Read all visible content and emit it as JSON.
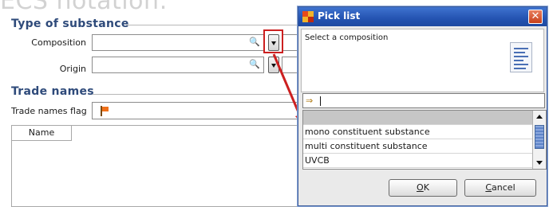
{
  "page": {
    "cut_off_heading": "ECS notation:"
  },
  "substance": {
    "title": "Type of substance",
    "composition_label": "Composition",
    "composition_value": "",
    "origin_label": "Origin",
    "origin_value": ""
  },
  "trade": {
    "title": "Trade names",
    "flag_label": "Trade names flag",
    "column_name": "Name"
  },
  "dialog": {
    "title": "Pick list",
    "close_glyph": "✕",
    "prompt": "Select a composition",
    "filter_value": "",
    "items": [
      {
        "label": ""
      },
      {
        "label": "mono constituent substance"
      },
      {
        "label": "multi constituent substance"
      },
      {
        "label": "UVCB"
      },
      {
        "label": ""
      }
    ],
    "ok_accel": "O",
    "ok_rest": "K",
    "cancel_accel": "C",
    "cancel_rest": "ancel"
  },
  "icons": {
    "search": "magnifier-icon",
    "dropdown": "triangle-down-icon",
    "flag": "flag-icon",
    "filter": "filter-icon",
    "document": "document-list-icon",
    "close": "close-icon"
  },
  "colors": {
    "section_title": "#2e4a7a",
    "highlight": "#cc2020",
    "dialog_titlebar": "#2453b1",
    "flag": "#f0701a"
  }
}
